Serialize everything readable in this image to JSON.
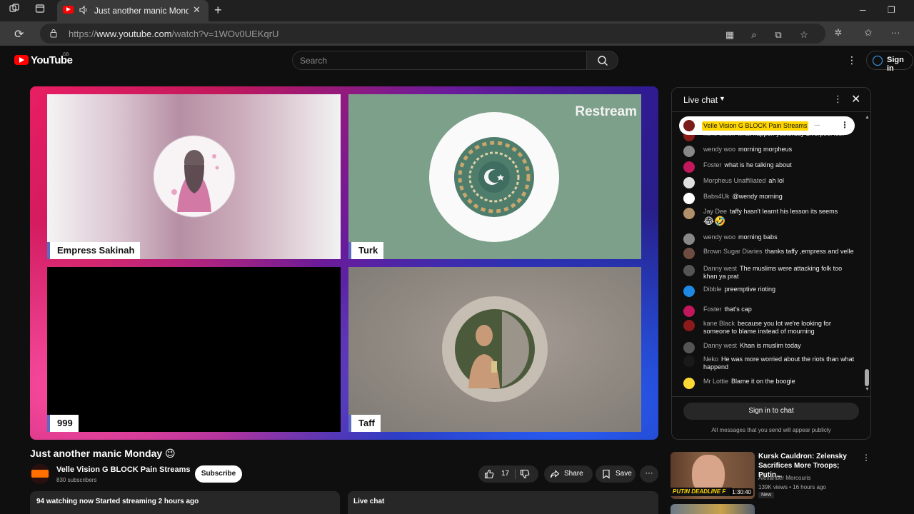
{
  "browser": {
    "tab_title": "Just another manic Monday",
    "url_prefix": "https://",
    "url_host": "www.youtube.com",
    "url_path": "/watch?v=1WOv0UEKqrU",
    "new_tab_glyph": "+",
    "minimize_glyph": "─",
    "restore_glyph": "❐"
  },
  "header": {
    "logo_text": "YouTube",
    "region": "GB",
    "search_placeholder": "Search",
    "sign_in": "Sign in"
  },
  "player": {
    "panes": [
      {
        "name": "Empress Sakinah"
      },
      {
        "name": "Turk"
      },
      {
        "name": "999"
      },
      {
        "name": "Taff"
      }
    ],
    "watermark": "Restream"
  },
  "video": {
    "title": "Just another manic Monday 😉",
    "channel": "Velle Vision G BLOCK Pain Streams",
    "subscribers": "830 subscribers",
    "subscribe_label": "Subscribe",
    "likes": "17",
    "share_label": "Share",
    "save_label": "Save",
    "more_glyph": "···",
    "watching": "94 watching now  Started streaming 2 hours ago",
    "live_chat_label": "Live chat"
  },
  "chat": {
    "title": "Live chat",
    "pinned_name": "Velle Vision G BLOCK Pain Streams",
    "pinned_ellipsis": "...",
    "messages": [
      {
        "author": "kane Black",
        "text": "what happen yesterday Liverpool lost",
        "avatar_color": "#8b1a1a"
      },
      {
        "author": "wendy woo",
        "text": "morning morpheus",
        "avatar_color": "#888888"
      },
      {
        "author": "Foster",
        "text": "what is he talking about",
        "avatar_color": "#c2185b"
      },
      {
        "author": "Morpheus Unaffiliated",
        "text": "ah lol",
        "avatar_color": "#e0e0e0"
      },
      {
        "author": "Babs4Uk",
        "text": "@wendy morning",
        "avatar_color": "#ffffff"
      },
      {
        "author": "Jay Dee",
        "text": "taffy hasn't learnt his lesson its seems",
        "emoji": "😂🤣",
        "avatar_color": "#b0906a"
      },
      {
        "author": "wendy woo",
        "text": "morning babs",
        "avatar_color": "#888888"
      },
      {
        "author": "Brown Sugar Diaries",
        "text": "thanks taffy ,empress and velle",
        "avatar_color": "#6d4c41"
      },
      {
        "author": "Danny west",
        "text": "The muslims were attacking folk too khan ya prat",
        "avatar_color": "#555555"
      },
      {
        "author": "Dibble",
        "text": "preemptive rioting",
        "avatar_color": "#1e88e5"
      },
      {
        "author": "Foster",
        "text": "that's cap",
        "avatar_color": "#c2185b"
      },
      {
        "author": "kane Black",
        "text": "because you lot we're looking for someone to blame instead of mourning",
        "avatar_color": "#8b1a1a"
      },
      {
        "author": "Danny west",
        "text": "Khan is muslim today",
        "avatar_color": "#555555"
      },
      {
        "author": "Neko",
        "text": "He was more worried about the riots than what happend",
        "avatar_color": "#1a1a1a"
      },
      {
        "author": "Mr Lottie",
        "text": "Blame it on the boogie",
        "avatar_color": "#fdd835"
      }
    ],
    "sign_in_label": "Sign in to chat",
    "note": "All messages that you send will appear publicly"
  },
  "recommendation": {
    "title": "Kursk Cauldron: Zelensky Sacrifices More Troops; Putin...",
    "channel": "Alexander Mercouris",
    "meta": "139K views  •  16 hours ago",
    "badge": "New",
    "duration": "1:30:40",
    "thumb_text": "PUTIN DEADLINE F"
  }
}
